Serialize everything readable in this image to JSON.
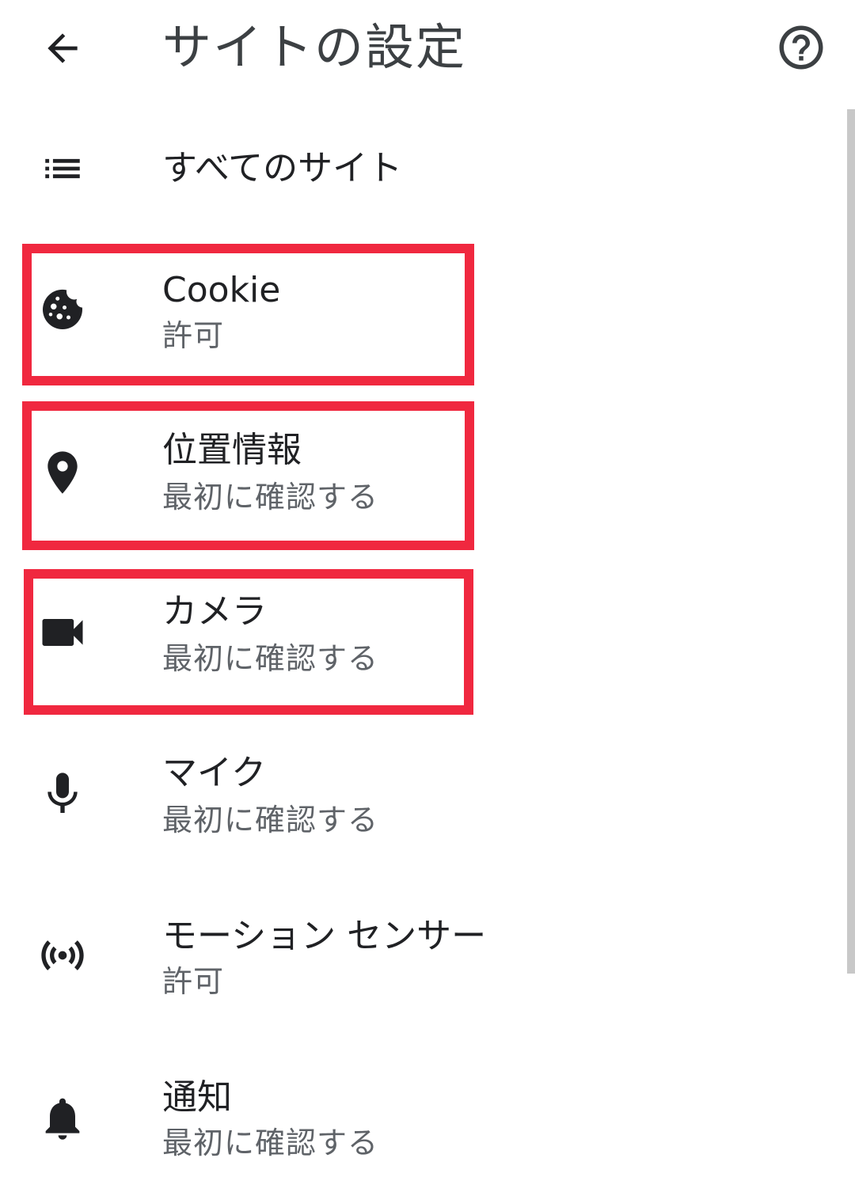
{
  "header": {
    "title": "サイトの設定",
    "back_icon": "arrow-back-icon",
    "help_icon": "help-circle-icon"
  },
  "all_sites": {
    "label": "すべてのサイト",
    "icon": "list-icon"
  },
  "items": [
    {
      "label": "Cookie",
      "status": "許可",
      "icon": "cookie-icon"
    },
    {
      "label": "位置情報",
      "status": "最初に確認する",
      "icon": "location-pin-icon"
    },
    {
      "label": "カメラ",
      "status": "最初に確認する",
      "icon": "videocam-icon"
    },
    {
      "label": "マイク",
      "status": "最初に確認する",
      "icon": "mic-icon"
    },
    {
      "label": "モーション センサー",
      "status": "許可",
      "icon": "sensors-icon"
    },
    {
      "label": "通知",
      "status": "最初に確認する",
      "icon": "bell-icon"
    }
  ],
  "colors": {
    "highlight": "#f0283f",
    "icon": "#202124",
    "title": "#3c4043",
    "secondary_text": "#5f6368"
  }
}
